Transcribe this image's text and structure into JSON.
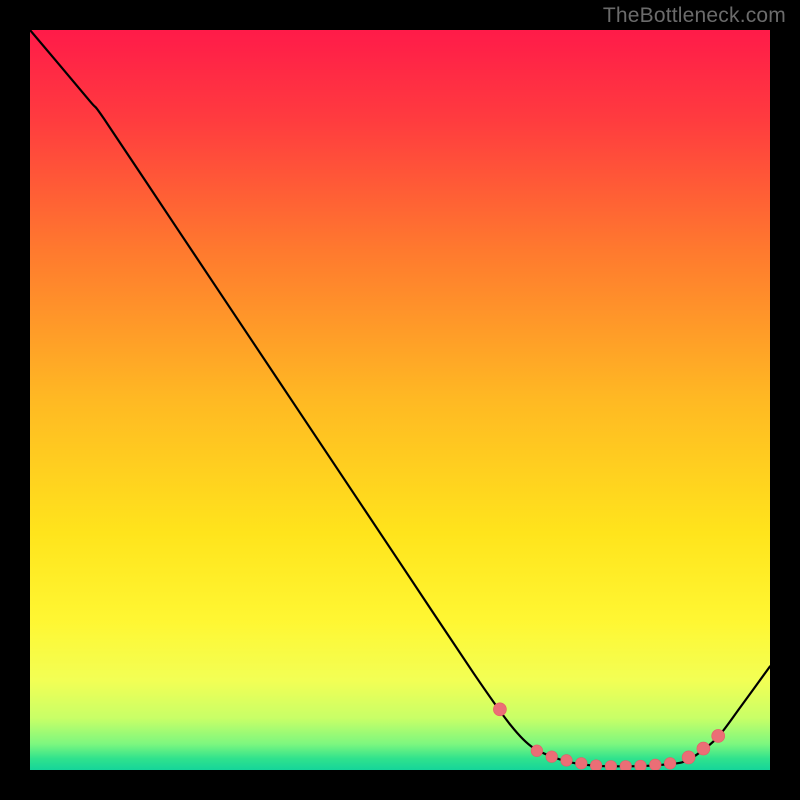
{
  "attribution": "TheBottleneck.com",
  "colors": {
    "curve": "#000000",
    "marker": "#eb6e76",
    "marker_stroke": "#e85a66"
  },
  "gradient_stops": [
    {
      "offset": 0.0,
      "color": "#ff1b49"
    },
    {
      "offset": 0.12,
      "color": "#ff3b3f"
    },
    {
      "offset": 0.3,
      "color": "#ff7a2e"
    },
    {
      "offset": 0.5,
      "color": "#ffb923"
    },
    {
      "offset": 0.68,
      "color": "#ffe41c"
    },
    {
      "offset": 0.8,
      "color": "#fff733"
    },
    {
      "offset": 0.88,
      "color": "#f2ff55"
    },
    {
      "offset": 0.93,
      "color": "#c8ff67"
    },
    {
      "offset": 0.965,
      "color": "#7cf77f"
    },
    {
      "offset": 0.985,
      "color": "#2fe28d"
    },
    {
      "offset": 1.0,
      "color": "#15d59a"
    }
  ],
  "chart_data": {
    "type": "line",
    "title": "",
    "xlabel": "",
    "ylabel": "",
    "xlim": [
      0,
      100
    ],
    "ylim": [
      0,
      100
    ],
    "series": [
      {
        "name": "bottleneck-curve",
        "x": [
          0,
          8,
          10,
          20,
          30,
          40,
          50,
          60,
          65,
          68,
          72,
          76,
          80,
          84,
          88,
          90,
          93,
          96,
          100
        ],
        "y": [
          100,
          90.5,
          88,
          73,
          58,
          43,
          28,
          13,
          6,
          3,
          1.3,
          0.6,
          0.5,
          0.6,
          1.0,
          2.0,
          4.5,
          8.5,
          14
        ]
      }
    ],
    "markers": {
      "name": "highlight-points",
      "x": [
        63.5,
        68.5,
        70.5,
        72.5,
        74.5,
        76.5,
        78.5,
        80.5,
        82.5,
        84.5,
        86.5,
        89.0,
        91.0,
        93.0
      ],
      "y": [
        8.2,
        2.6,
        1.8,
        1.3,
        0.9,
        0.6,
        0.5,
        0.5,
        0.55,
        0.7,
        0.9,
        1.7,
        2.9,
        4.6
      ]
    }
  }
}
